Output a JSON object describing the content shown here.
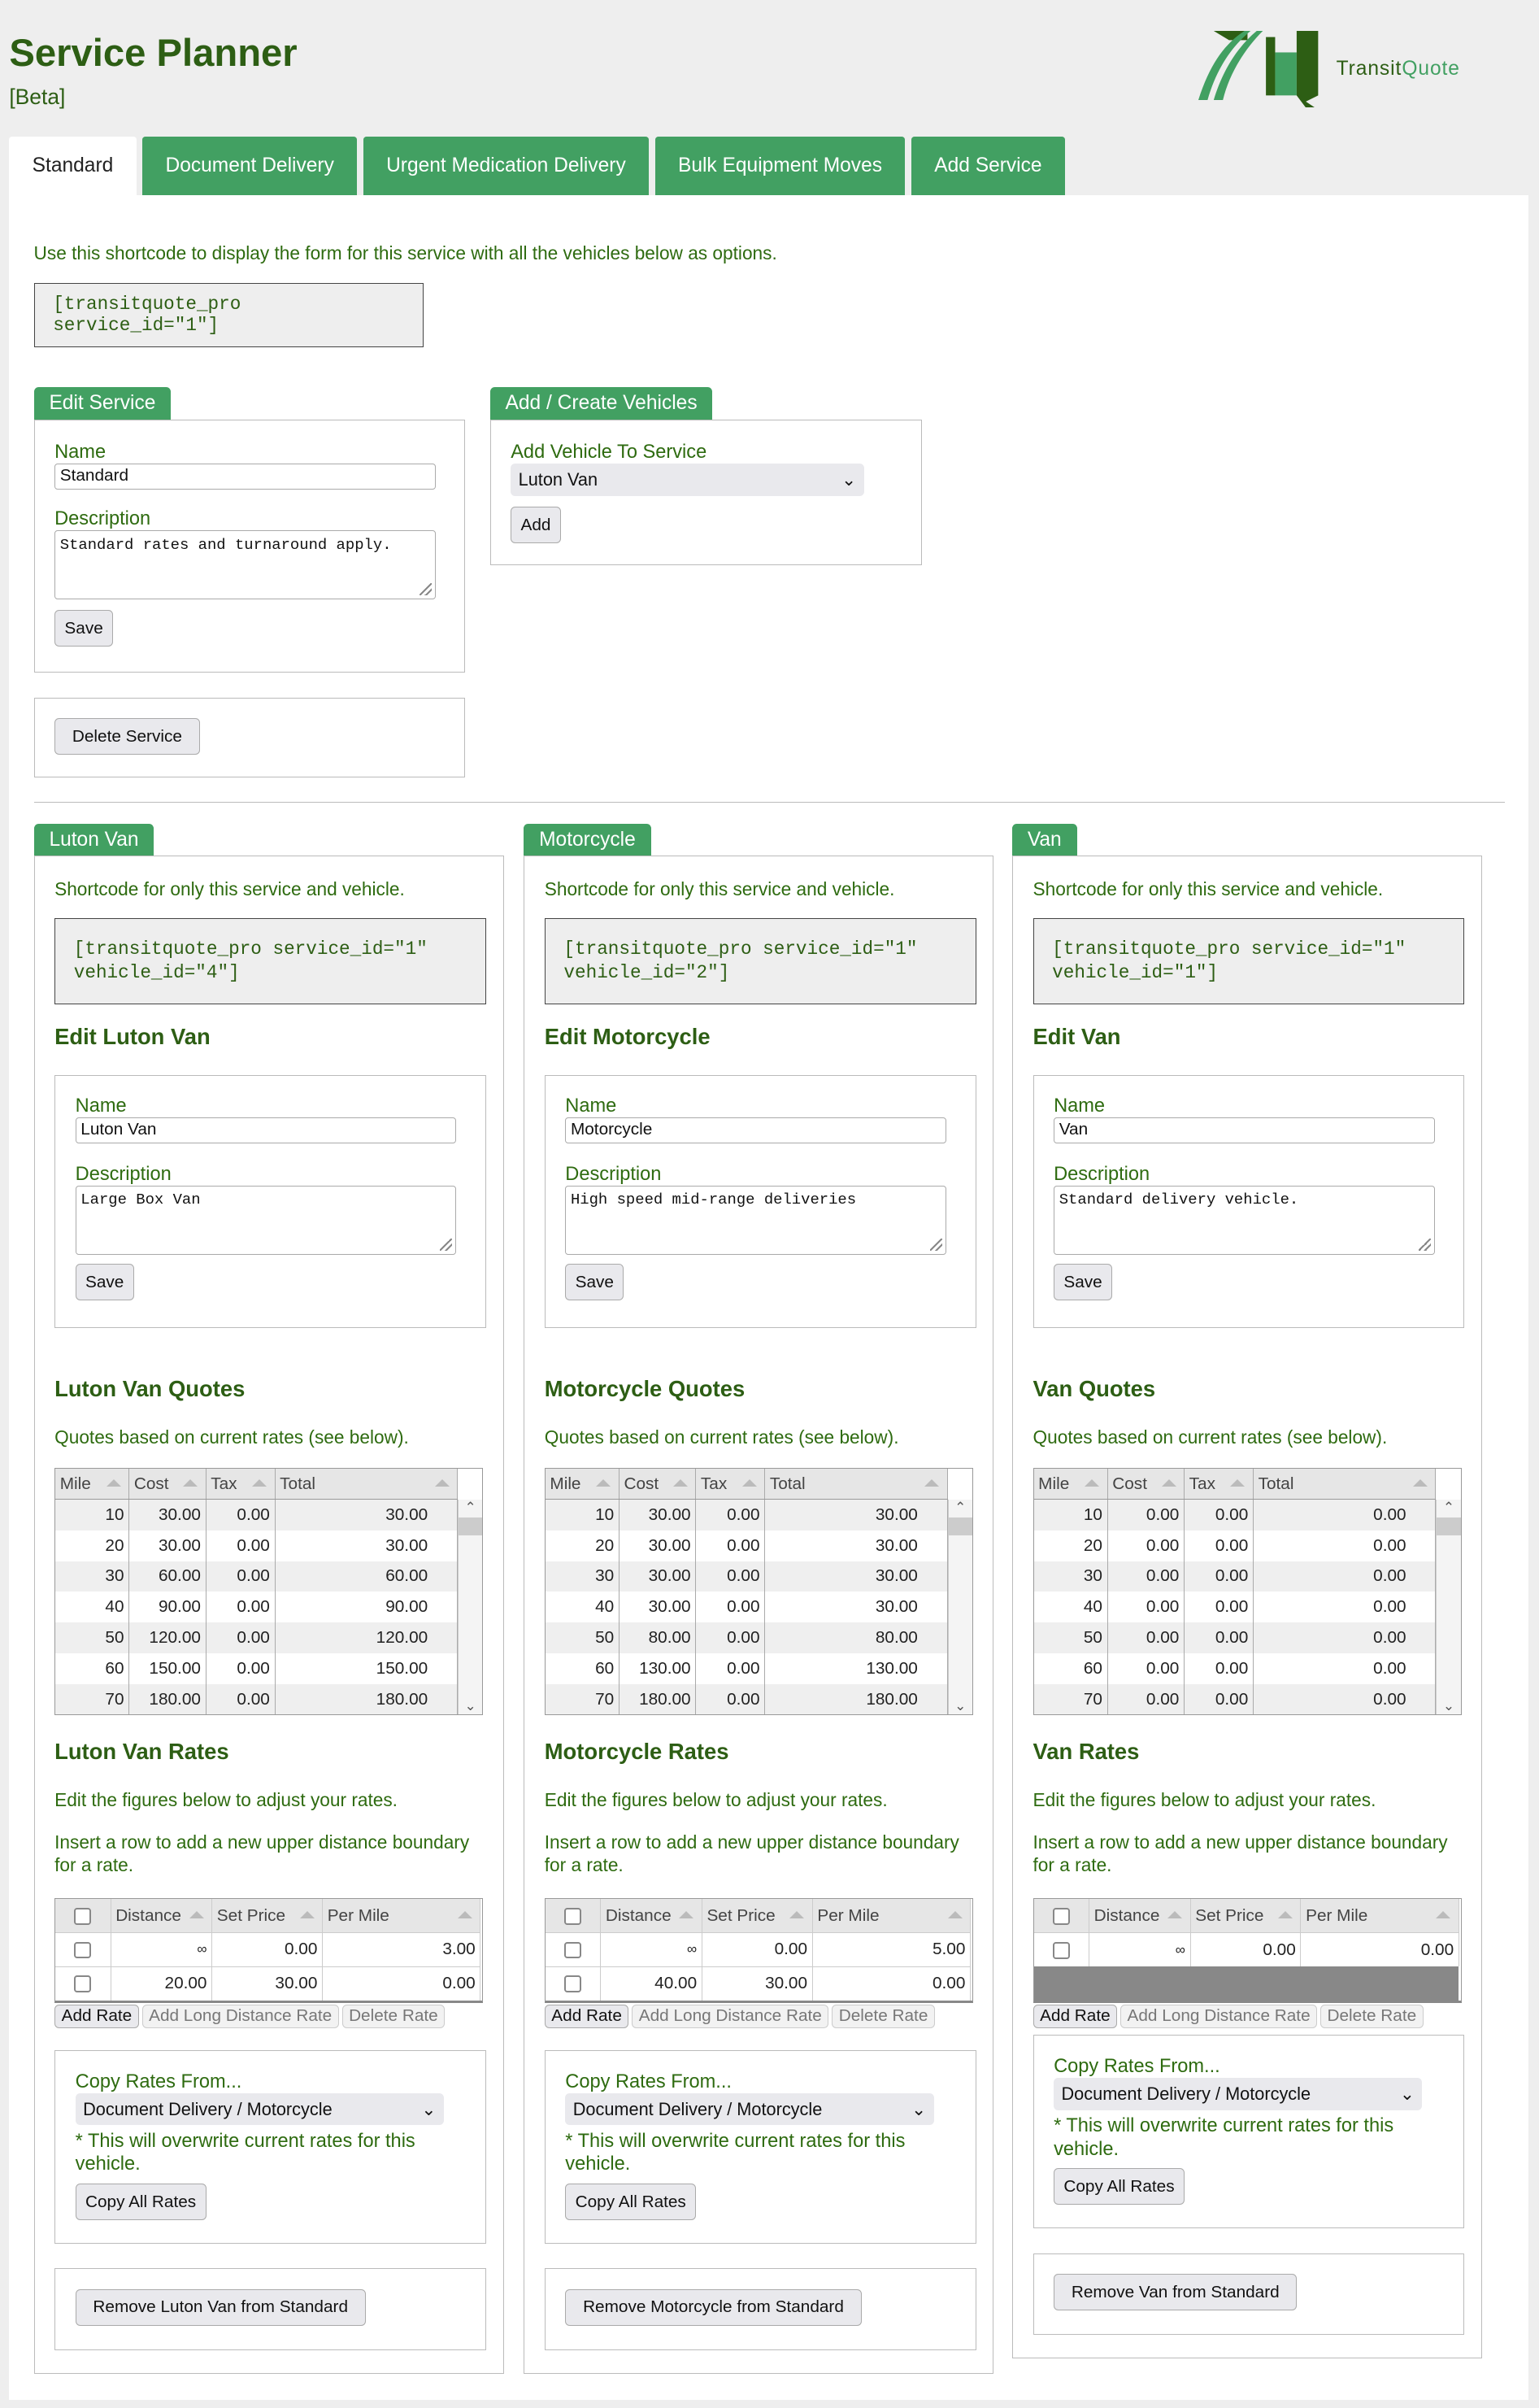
{
  "header": {
    "title": "Service Planner",
    "badge": "[Beta]",
    "logo_text_1": "Transit",
    "logo_text_2": "Quote"
  },
  "tabs": [
    {
      "label": "Standard",
      "active": true
    },
    {
      "label": "Document Delivery"
    },
    {
      "label": "Urgent Medication Delivery"
    },
    {
      "label": "Bulk Equipment Moves"
    },
    {
      "label": "Add Service"
    }
  ],
  "service": {
    "intro": "Use this shortcode to display the form for this service with all the vehicles below as options.",
    "shortcode": "[transitquote_pro service_id=\"1\"]",
    "edit_tab": "Edit Service",
    "name_label": "Name",
    "name_value": "Standard",
    "desc_label": "Description",
    "desc_value": "Standard rates and turnaround apply.",
    "save": "Save",
    "vehicles_tab": "Add / Create Vehicles",
    "add_vehicle_label": "Add Vehicle To Service",
    "add_vehicle_value": "Luton Van",
    "add": "Add",
    "delete": "Delete Service"
  },
  "common": {
    "shortcode_hint": "Shortcode for only this service and vehicle.",
    "name_label": "Name",
    "desc_label": "Description",
    "save": "Save",
    "quotes_hint": "Quotes based on current rates (see below).",
    "quote_headers": [
      "Mile",
      "Cost",
      "Tax",
      "Total"
    ],
    "rates_hint_1": "Edit the figures below to adjust your rates.",
    "rates_hint_2": "Insert a row to add a new upper distance boundary for a rate.",
    "rate_headers": [
      "Distance",
      "Set Price",
      "Per Mile"
    ],
    "add_rate": "Add Rate",
    "add_long": "Add Long Distance Rate",
    "delete_rate": "Delete Rate",
    "copy_label": "Copy Rates From...",
    "copy_value": "Document Delivery / Motorcycle",
    "copy_warning": "* This will overwrite current rates for this vehicle.",
    "copy_btn": "Copy All Rates"
  },
  "vehicles": [
    {
      "name": "Luton Van",
      "shortcode": "[transitquote_pro service_id=\"1\" vehicle_id=\"4\"]",
      "edit_title": "Edit Luton Van",
      "desc": "Large Box Van",
      "quotes_title": "Luton Van Quotes",
      "rates_title": "Luton Van Rates",
      "quotes": [
        [
          "10",
          "30.00",
          "0.00",
          "30.00"
        ],
        [
          "20",
          "30.00",
          "0.00",
          "30.00"
        ],
        [
          "30",
          "60.00",
          "0.00",
          "60.00"
        ],
        [
          "40",
          "90.00",
          "0.00",
          "90.00"
        ],
        [
          "50",
          "120.00",
          "0.00",
          "120.00"
        ],
        [
          "60",
          "150.00",
          "0.00",
          "150.00"
        ],
        [
          "70",
          "180.00",
          "0.00",
          "180.00"
        ]
      ],
      "rates": [
        [
          "∞",
          "0.00",
          "3.00"
        ],
        [
          "20.00",
          "30.00",
          "0.00"
        ]
      ],
      "remove": "Remove Luton Van from Standard"
    },
    {
      "name": "Motorcycle",
      "shortcode": "[transitquote_pro service_id=\"1\" vehicle_id=\"2\"]",
      "edit_title": "Edit Motorcycle",
      "desc": "High speed mid-range deliveries",
      "quotes_title": "Motorcycle Quotes",
      "rates_title": "Motorcycle Rates",
      "quotes": [
        [
          "10",
          "30.00",
          "0.00",
          "30.00"
        ],
        [
          "20",
          "30.00",
          "0.00",
          "30.00"
        ],
        [
          "30",
          "30.00",
          "0.00",
          "30.00"
        ],
        [
          "40",
          "30.00",
          "0.00",
          "30.00"
        ],
        [
          "50",
          "80.00",
          "0.00",
          "80.00"
        ],
        [
          "60",
          "130.00",
          "0.00",
          "130.00"
        ],
        [
          "70",
          "180.00",
          "0.00",
          "180.00"
        ]
      ],
      "rates": [
        [
          "∞",
          "0.00",
          "5.00"
        ],
        [
          "40.00",
          "30.00",
          "0.00"
        ]
      ],
      "remove": "Remove Motorcycle from Standard"
    },
    {
      "name": "Van",
      "shortcode": "[transitquote_pro service_id=\"1\" vehicle_id=\"1\"]",
      "edit_title": "Edit Van",
      "desc": "Standard delivery vehicle.",
      "quotes_title": "Van Quotes",
      "rates_title": "Van Rates",
      "quotes": [
        [
          "10",
          "0.00",
          "0.00",
          "0.00"
        ],
        [
          "20",
          "0.00",
          "0.00",
          "0.00"
        ],
        [
          "30",
          "0.00",
          "0.00",
          "0.00"
        ],
        [
          "40",
          "0.00",
          "0.00",
          "0.00"
        ],
        [
          "50",
          "0.00",
          "0.00",
          "0.00"
        ],
        [
          "60",
          "0.00",
          "0.00",
          "0.00"
        ],
        [
          "70",
          "0.00",
          "0.00",
          "0.00"
        ]
      ],
      "rates": [
        [
          "∞",
          "0.00",
          "0.00"
        ]
      ],
      "remove": "Remove Van from Standard"
    }
  ],
  "colors": {
    "accent": "#42a062",
    "heading": "#2d5e14",
    "background": "#eeeeee"
  }
}
